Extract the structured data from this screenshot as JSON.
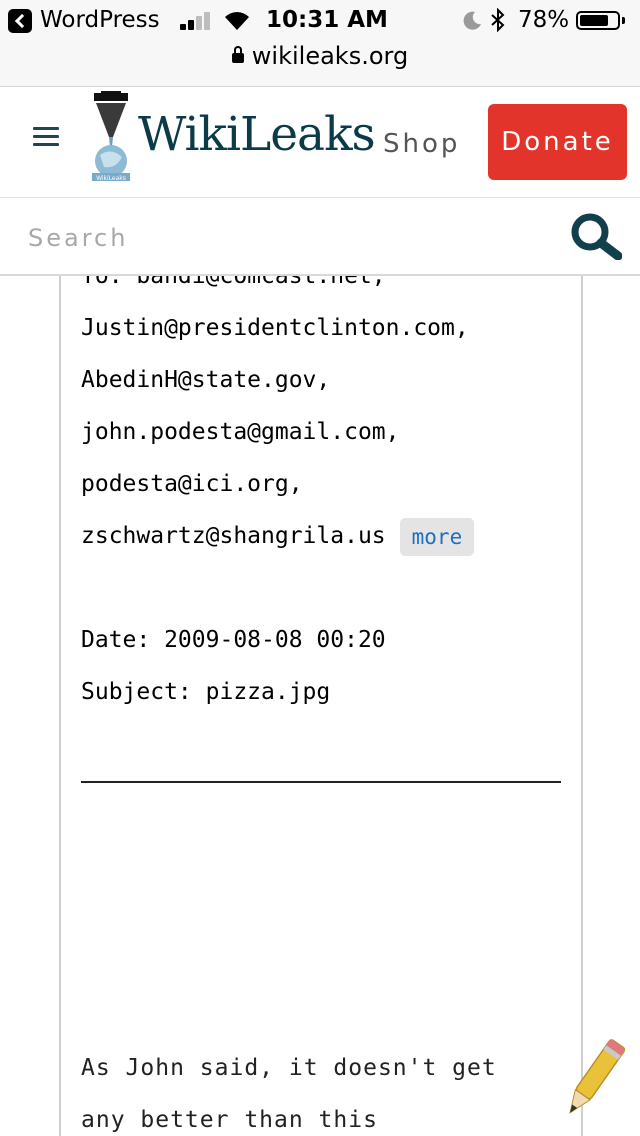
{
  "status_bar": {
    "back_app": "WordPress",
    "time": "10:31 AM",
    "battery_percent": "78%",
    "battery_level": 0.78,
    "signal_bars_filled": 2,
    "signal_bars_total": 4,
    "icons": [
      "back-arrow-icon",
      "signal-icon",
      "wifi-icon",
      "moon-icon",
      "bluetooth-icon",
      "battery-icon"
    ]
  },
  "url_bar": {
    "domain": "wikileaks.org",
    "icon": "lock-icon"
  },
  "header": {
    "logo_text": "WikiLeaks",
    "logo_subtext": "WikiLeaks",
    "shop_label": "Shop",
    "donate_label": "Donate",
    "colors": {
      "donate": "#e2342b",
      "brand": "#0b3a49",
      "nav_icon": "#1f4652"
    }
  },
  "search": {
    "placeholder": "Search",
    "icon": "search-icon"
  },
  "email": {
    "to_partial": "To: bandi@comcast.net,",
    "recipients": [
      "Justin@presidentclinton.com,",
      "AbedinH@state.gov,",
      "john.podesta@gmail.com,",
      "podesta@ici.org,",
      "zschwartz@shangrila.us"
    ],
    "more_label": "more",
    "date_line": "Date: 2009-08-08 00:20",
    "subject_line": "Subject: pizza.jpg",
    "body_lines": [
      "As John said, it doesn't get",
      "any better than this"
    ],
    "link_color": "#1d6fbf"
  }
}
